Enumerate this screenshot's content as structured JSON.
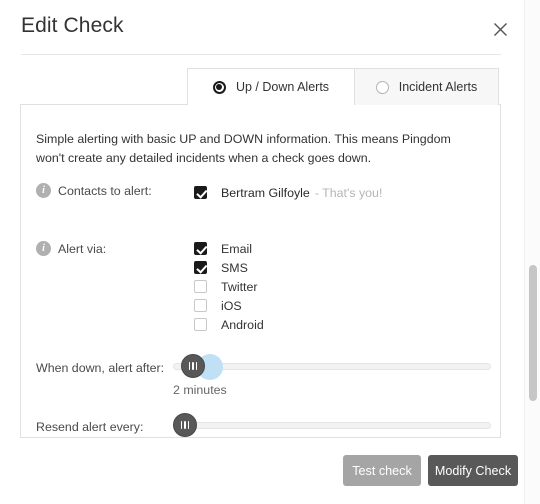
{
  "header": {
    "title": "Edit Check",
    "close_icon": "close-icon"
  },
  "tabs": [
    {
      "label": "Up / Down Alerts",
      "selected": true
    },
    {
      "label": "Incident Alerts",
      "selected": false
    }
  ],
  "panel": {
    "description": "Simple alerting with basic UP and DOWN information. This means Pingdom won't create any detailed incidents when a check goes down.",
    "contacts": {
      "label": "Contacts to alert:",
      "info_icon": "info-icon",
      "items": [
        {
          "name": "Bertram Gilfoyle",
          "note": "- That's you!",
          "checked": true
        }
      ]
    },
    "alert_via": {
      "label": "Alert via:",
      "info_icon": "info-icon",
      "options": [
        {
          "label": "Email",
          "checked": true
        },
        {
          "label": "SMS",
          "checked": true
        },
        {
          "label": "Twitter",
          "checked": false
        },
        {
          "label": "iOS",
          "checked": false
        },
        {
          "label": "Android",
          "checked": false
        }
      ]
    },
    "when_down": {
      "label": "When down, alert after:",
      "value_text": "2 minutes"
    },
    "resend": {
      "label": "Resend alert every:",
      "value_text": ""
    }
  },
  "footer": {
    "test_label": "Test check",
    "modify_label": "Modify Check"
  },
  "colors": {
    "accent_blue": "#bfe0f5",
    "knob": "#585858",
    "primary_button": "#595959",
    "secondary_button": "#a5a5a5"
  }
}
